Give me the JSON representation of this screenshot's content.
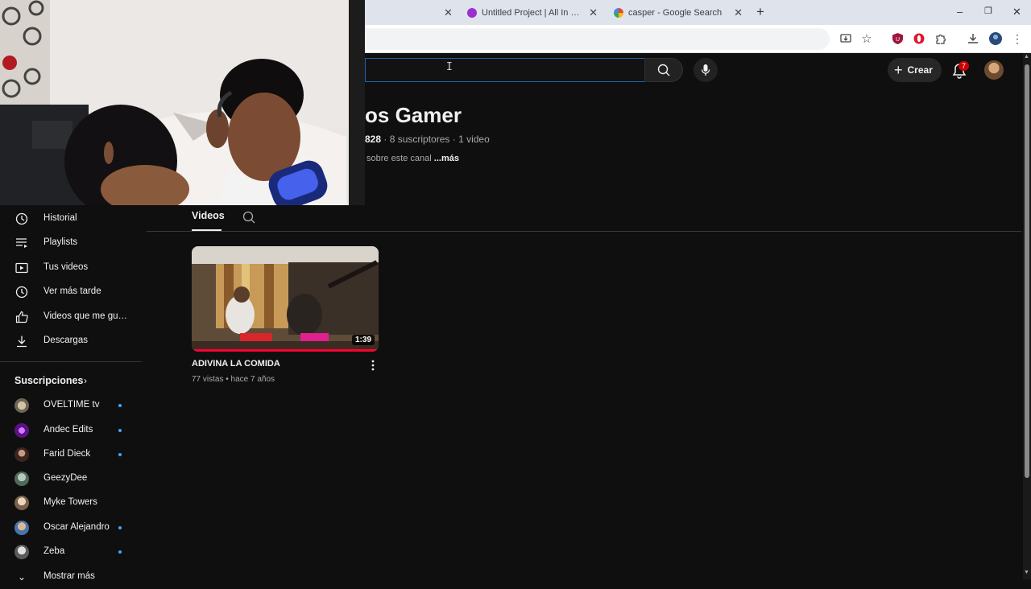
{
  "browser": {
    "tabs": [
      {
        "title": "Untitled Project | All In One Web E",
        "favicon_color": "#9c2fd0"
      },
      {
        "title": "casper - Google Search",
        "favicon_color": "#4285f4"
      }
    ],
    "new_tab": "+",
    "window_controls": {
      "minimize": "–",
      "restore": "❐",
      "close": "✕"
    }
  },
  "header": {
    "search_placeholder": "",
    "create_label": "Crear",
    "notifications_count": "7"
  },
  "channel": {
    "name_visible": "os Gamer",
    "handle_fragment": "828",
    "stats": "· 8 suscriptores · 1 video",
    "description": "sobre este canal",
    "more_label": "...más"
  },
  "tabs": {
    "videos_label": "Videos"
  },
  "sidebar": {
    "items": [
      {
        "label": "Historial",
        "icon": "history-icon"
      },
      {
        "label": "Playlists",
        "icon": "playlist-icon"
      },
      {
        "label": "Tus videos",
        "icon": "your-videos-icon"
      },
      {
        "label": "Ver más tarde",
        "icon": "watch-later-icon"
      },
      {
        "label": "Videos que me gus...",
        "icon": "like-icon"
      },
      {
        "label": "Descargas",
        "icon": "download-icon"
      }
    ],
    "subscriptions_title": "Suscripciones",
    "subscriptions": [
      {
        "name": "OVELTIME tv",
        "new": true,
        "color": "#9a8f7a"
      },
      {
        "name": "Andec Edits",
        "new": true,
        "color": "#7b1fa2"
      },
      {
        "name": "Farid Dieck",
        "new": true,
        "color": "#7a4a3a"
      },
      {
        "name": "GeezyDee",
        "new": false,
        "color": "#6b8a7a"
      },
      {
        "name": "Myke Towers",
        "new": false,
        "color": "#8a7560"
      },
      {
        "name": "Oscar Alejandro",
        "new": true,
        "color": "#5a7fa8"
      },
      {
        "name": "Zeba",
        "new": true,
        "color": "#b0b0b0"
      }
    ],
    "show_more": "Mostrar más"
  },
  "video": {
    "title": "ADIVINA LA COMIDA",
    "duration": "1:39",
    "views": "77 vistas",
    "age": "hace 7 años",
    "separator": "•"
  }
}
